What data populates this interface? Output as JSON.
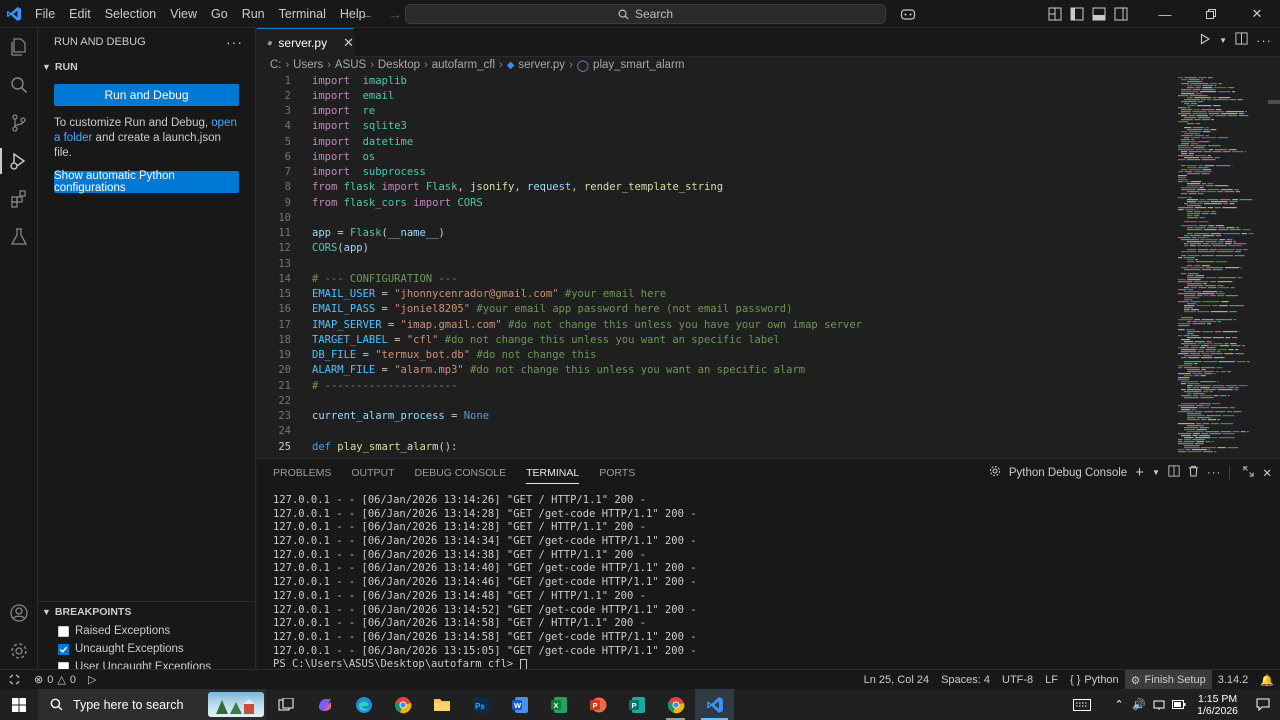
{
  "menu": [
    "File",
    "Edit",
    "Selection",
    "View",
    "Go",
    "Run",
    "Terminal",
    "Help"
  ],
  "search": {
    "label": "Search"
  },
  "sidebar": {
    "title": "RUN AND DEBUG",
    "section": "RUN",
    "run_button": "Run and Debug",
    "text_before": "To customize Run and Debug, ",
    "link_open": "open a folder",
    "text_after": " and create a launch.json file.",
    "auto_button": "Show automatic Python configurations",
    "breakpoints_title": "BREAKPOINTS",
    "breakpoints": [
      {
        "label": "Raised Exceptions",
        "checked": false
      },
      {
        "label": "Uncaught Exceptions",
        "checked": true
      },
      {
        "label": "User Uncaught Exceptions",
        "checked": false
      }
    ]
  },
  "tab": {
    "name": "server.py"
  },
  "breadcrumb": [
    "C:",
    "Users",
    "ASUS",
    "Desktop",
    "autofarm_cfl",
    "server.py",
    "play_smart_alarm"
  ],
  "code_lines": [
    {
      "n": "1",
      "toks": [
        [
          "kw",
          "import"
        ],
        [
          "",
          "  "
        ],
        [
          "cls",
          "imaplib"
        ]
      ]
    },
    {
      "n": "2",
      "toks": [
        [
          "kw",
          "import"
        ],
        [
          "",
          "  "
        ],
        [
          "cls",
          "email"
        ]
      ]
    },
    {
      "n": "3",
      "toks": [
        [
          "kw",
          "import"
        ],
        [
          "",
          "  "
        ],
        [
          "cls",
          "re"
        ]
      ]
    },
    {
      "n": "4",
      "toks": [
        [
          "kw",
          "import"
        ],
        [
          "",
          "  "
        ],
        [
          "cls",
          "sqlite3"
        ]
      ]
    },
    {
      "n": "5",
      "toks": [
        [
          "kw",
          "import"
        ],
        [
          "",
          "  "
        ],
        [
          "cls",
          "datetime"
        ]
      ]
    },
    {
      "n": "6",
      "toks": [
        [
          "kw",
          "import"
        ],
        [
          "",
          "  "
        ],
        [
          "cls",
          "os"
        ]
      ]
    },
    {
      "n": "7",
      "toks": [
        [
          "kw",
          "import"
        ],
        [
          "",
          "  "
        ],
        [
          "cls",
          "subprocess"
        ]
      ]
    },
    {
      "n": "8",
      "toks": [
        [
          "kw",
          "from"
        ],
        [
          "",
          " "
        ],
        [
          "cls",
          "flask"
        ],
        [
          "",
          " "
        ],
        [
          "kw",
          "import"
        ],
        [
          "",
          " "
        ],
        [
          "cls",
          "Flask"
        ],
        [
          "",
          ", "
        ],
        [
          "fn",
          "jsonify"
        ],
        [
          "",
          ", "
        ],
        [
          "var",
          "request"
        ],
        [
          "",
          ", "
        ],
        [
          "fn",
          "render_template_string"
        ]
      ]
    },
    {
      "n": "9",
      "toks": [
        [
          "kw",
          "from"
        ],
        [
          "",
          " "
        ],
        [
          "cls",
          "flask_cors"
        ],
        [
          "",
          " "
        ],
        [
          "kw",
          "import"
        ],
        [
          "",
          " "
        ],
        [
          "cls",
          "CORS"
        ]
      ]
    },
    {
      "n": "10",
      "toks": []
    },
    {
      "n": "11",
      "toks": [
        [
          "var",
          "app"
        ],
        [
          "",
          " = "
        ],
        [
          "cls",
          "Flask"
        ],
        [
          "",
          "("
        ],
        [
          "var",
          "__name__"
        ],
        [
          "",
          ")"
        ]
      ]
    },
    {
      "n": "12",
      "toks": [
        [
          "cls",
          "CORS"
        ],
        [
          "",
          "("
        ],
        [
          "var",
          "app"
        ],
        [
          "",
          ")"
        ]
      ]
    },
    {
      "n": "13",
      "toks": []
    },
    {
      "n": "14",
      "toks": [
        [
          "cm",
          "# --- CONFIGURATION ---"
        ]
      ]
    },
    {
      "n": "15",
      "toks": [
        [
          "cst",
          "EMAIL_USER"
        ],
        [
          "",
          " = "
        ],
        [
          "str",
          "\"jhonnycenrador@gmail.com\""
        ],
        [
          "",
          " "
        ],
        [
          "cm",
          "#your email here"
        ]
      ]
    },
    {
      "n": "16",
      "toks": [
        [
          "cst",
          "EMAIL_PASS"
        ],
        [
          "",
          " = "
        ],
        [
          "str",
          "\"joniel8205\""
        ],
        [
          "",
          " "
        ],
        [
          "cm",
          "#your email app password here (not email password)"
        ]
      ]
    },
    {
      "n": "17",
      "toks": [
        [
          "cst",
          "IMAP_SERVER"
        ],
        [
          "",
          " = "
        ],
        [
          "str",
          "\"imap.gmail.com\""
        ],
        [
          "",
          " "
        ],
        [
          "cm",
          "#do not change this unless you have your own imap server"
        ]
      ]
    },
    {
      "n": "18",
      "toks": [
        [
          "cst",
          "TARGET_LABEL"
        ],
        [
          "",
          " = "
        ],
        [
          "str",
          "\"cfl\""
        ],
        [
          "",
          " "
        ],
        [
          "cm",
          "#do not change this unless you want an specific label"
        ]
      ]
    },
    {
      "n": "19",
      "toks": [
        [
          "cst",
          "DB_FILE"
        ],
        [
          "",
          " = "
        ],
        [
          "str",
          "\"termux_bot.db\""
        ],
        [
          "",
          " "
        ],
        [
          "cm",
          "#do not change this"
        ]
      ]
    },
    {
      "n": "20",
      "toks": [
        [
          "cst",
          "ALARM_FILE"
        ],
        [
          "",
          " = "
        ],
        [
          "str",
          "\"alarm.mp3\""
        ],
        [
          "",
          " "
        ],
        [
          "cm",
          "#do not change this unless you want an specific alarm"
        ]
      ]
    },
    {
      "n": "21",
      "toks": [
        [
          "cm",
          "# ---------------------"
        ]
      ]
    },
    {
      "n": "22",
      "toks": []
    },
    {
      "n": "23",
      "toks": [
        [
          "var",
          "current_alarm_process"
        ],
        [
          "",
          " = "
        ],
        [
          "kw2",
          "None"
        ]
      ]
    },
    {
      "n": "24",
      "toks": []
    },
    {
      "n": "25",
      "toks": [
        [
          "kw2",
          "def"
        ],
        [
          "",
          " "
        ],
        [
          "fn",
          "play_smart_alarm"
        ],
        [
          "",
          "():"
        ]
      ]
    }
  ],
  "panel_tabs": [
    "PROBLEMS",
    "OUTPUT",
    "DEBUG CONSOLE",
    "TERMINAL",
    "PORTS"
  ],
  "panel_active": "TERMINAL",
  "panel_console": "Python Debug Console",
  "terminal_lines": [
    "127.0.0.1 - - [06/Jan/2026 13:14:26] \"GET / HTTP/1.1\" 200 -",
    "127.0.0.1 - - [06/Jan/2026 13:14:28] \"GET /get-code HTTP/1.1\" 200 -",
    "127.0.0.1 - - [06/Jan/2026 13:14:28] \"GET / HTTP/1.1\" 200 -",
    "127.0.0.1 - - [06/Jan/2026 13:14:34] \"GET /get-code HTTP/1.1\" 200 -",
    "127.0.0.1 - - [06/Jan/2026 13:14:38] \"GET / HTTP/1.1\" 200 -",
    "127.0.0.1 - - [06/Jan/2026 13:14:40] \"GET /get-code HTTP/1.1\" 200 -",
    "127.0.0.1 - - [06/Jan/2026 13:14:46] \"GET /get-code HTTP/1.1\" 200 -",
    "127.0.0.1 - - [06/Jan/2026 13:14:48] \"GET / HTTP/1.1\" 200 -",
    "127.0.0.1 - - [06/Jan/2026 13:14:52] \"GET /get-code HTTP/1.1\" 200 -",
    "127.0.0.1 - - [06/Jan/2026 13:14:58] \"GET / HTTP/1.1\" 200 -",
    "127.0.0.1 - - [06/Jan/2026 13:14:58] \"GET /get-code HTTP/1.1\" 200 -",
    "127.0.0.1 - - [06/Jan/2026 13:15:05] \"GET /get-code HTTP/1.1\" 200 -"
  ],
  "terminal_prompt": "PS C:\\Users\\ASUS\\Desktop\\autofarm_cfl> ",
  "status": {
    "errors": "0",
    "warnings": "0",
    "position": "Ln 25, Col 24",
    "spaces": "Spaces: 4",
    "encoding": "UTF-8",
    "eol": "LF",
    "language": "Python",
    "finish_setup": "Finish Setup",
    "version": "3.14.2"
  },
  "taskbar": {
    "search_placeholder": "Type here to search",
    "time": "1:15 PM",
    "date": "1/6/2026"
  },
  "colors": {
    "accent": "#0078d4",
    "background": "#1f1f1f",
    "sidebar": "#181818"
  }
}
